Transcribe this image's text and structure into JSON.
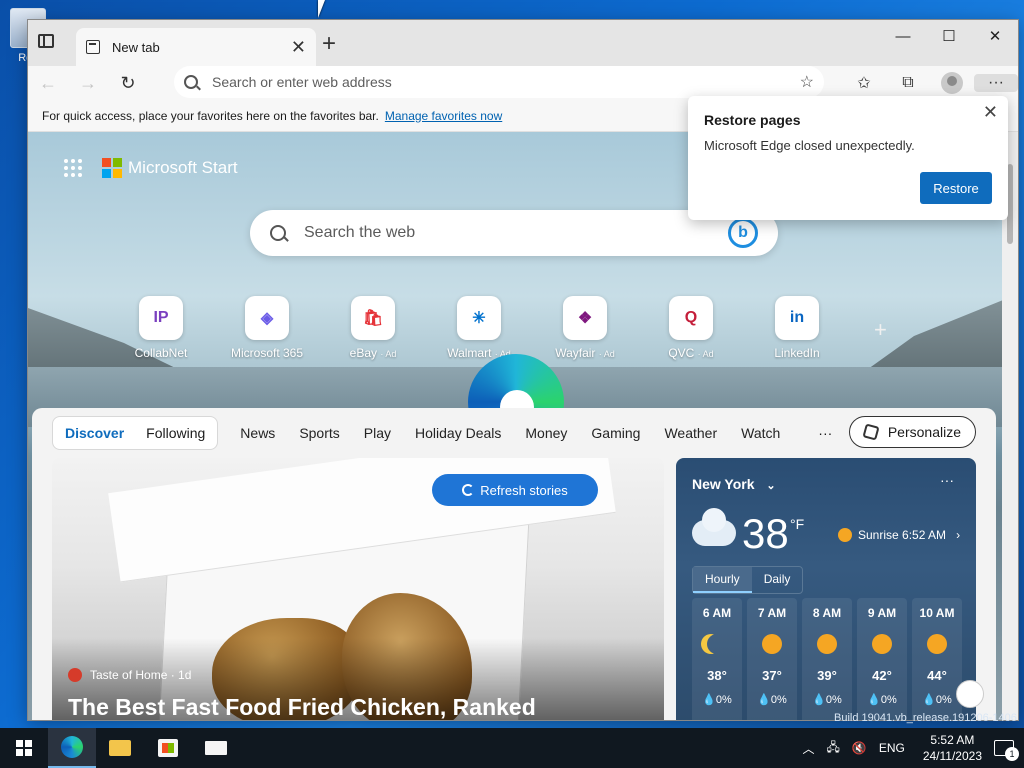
{
  "desktop": {
    "recycle_bin_label": "Rec"
  },
  "browser": {
    "tab_title": "New tab",
    "tab_close": "✕",
    "new_tab": "+",
    "window_controls": {
      "minimize": "—",
      "maximize": "☐",
      "close": "✕"
    },
    "address_placeholder": "Search or enter web address",
    "favorites_bar": {
      "text": "For quick access, place your favorites here on the favorites bar.",
      "link": "Manage favorites now"
    }
  },
  "restore_popup": {
    "title": "Restore pages",
    "message": "Microsoft Edge closed unexpectedly.",
    "button": "Restore",
    "close": "✕"
  },
  "start": {
    "brand": "Microsoft Start",
    "search_placeholder": "Search the web",
    "bing_label": "b",
    "quick_links": [
      {
        "label": "CollabNet",
        "ad": "",
        "icon": "collabnet-icon",
        "color": "#7a3fbf",
        "glyph": "IP"
      },
      {
        "label": "Microsoft 365",
        "ad": "",
        "icon": "microsoft-365-icon",
        "color": "#6b5ce7",
        "glyph": "◈"
      },
      {
        "label": "eBay",
        "ad": "· Ad",
        "icon": "ebay-icon",
        "color": "#e53238",
        "glyph": "🛍"
      },
      {
        "label": "Walmart",
        "ad": "· Ad",
        "icon": "walmart-icon",
        "color": "#0071ce",
        "glyph": "✳"
      },
      {
        "label": "Wayfair",
        "ad": "· Ad",
        "icon": "wayfair-icon",
        "color": "#7f187f",
        "glyph": "❖"
      },
      {
        "label": "QVC",
        "ad": "· Ad",
        "icon": "qvc-icon",
        "color": "#c41e3a",
        "glyph": "Q"
      },
      {
        "label": "LinkedIn",
        "ad": "",
        "icon": "linkedin-icon",
        "color": "#0a66c2",
        "glyph": "in"
      }
    ],
    "add_link": "+"
  },
  "feed": {
    "pill_tabs": [
      "Discover",
      "Following"
    ],
    "links": [
      "News",
      "Sports",
      "Play",
      "Holiday Deals",
      "Money",
      "Gaming",
      "Weather",
      "Watch"
    ],
    "more": "···",
    "personalize": "Personalize",
    "refresh": "Refresh stories",
    "story": {
      "source": "Taste of Home · 1d",
      "title": "The Best Fast Food Fried Chicken, Ranked"
    }
  },
  "weather": {
    "location": "New York",
    "location_chevron": "⌄",
    "more": "···",
    "temp": "38",
    "unit": "°F",
    "sunrise": "Sunrise 6:52 AM",
    "sunrise_chevron": "›",
    "tabs": [
      "Hourly",
      "Daily"
    ],
    "hours": [
      {
        "time": "6 AM",
        "temp": "38°",
        "precip": "💧0%",
        "icon": "moon"
      },
      {
        "time": "7 AM",
        "temp": "37°",
        "precip": "💧0%",
        "icon": "sun"
      },
      {
        "time": "8 AM",
        "temp": "39°",
        "precip": "💧0%",
        "icon": "sun"
      },
      {
        "time": "9 AM",
        "temp": "42°",
        "precip": "💧0%",
        "icon": "sun"
      },
      {
        "time": "10 AM",
        "temp": "44°",
        "precip": "💧0%",
        "icon": "sun"
      }
    ]
  },
  "system": {
    "build": "Build 19041.vb_release.191206-1406",
    "tray_chevron": "︿",
    "language": "ENG",
    "time": "5:52 AM",
    "date": "24/11/2023",
    "notifications": "1"
  },
  "colors": {
    "accent": "#0f6cbd",
    "taskbar": "#101820"
  }
}
